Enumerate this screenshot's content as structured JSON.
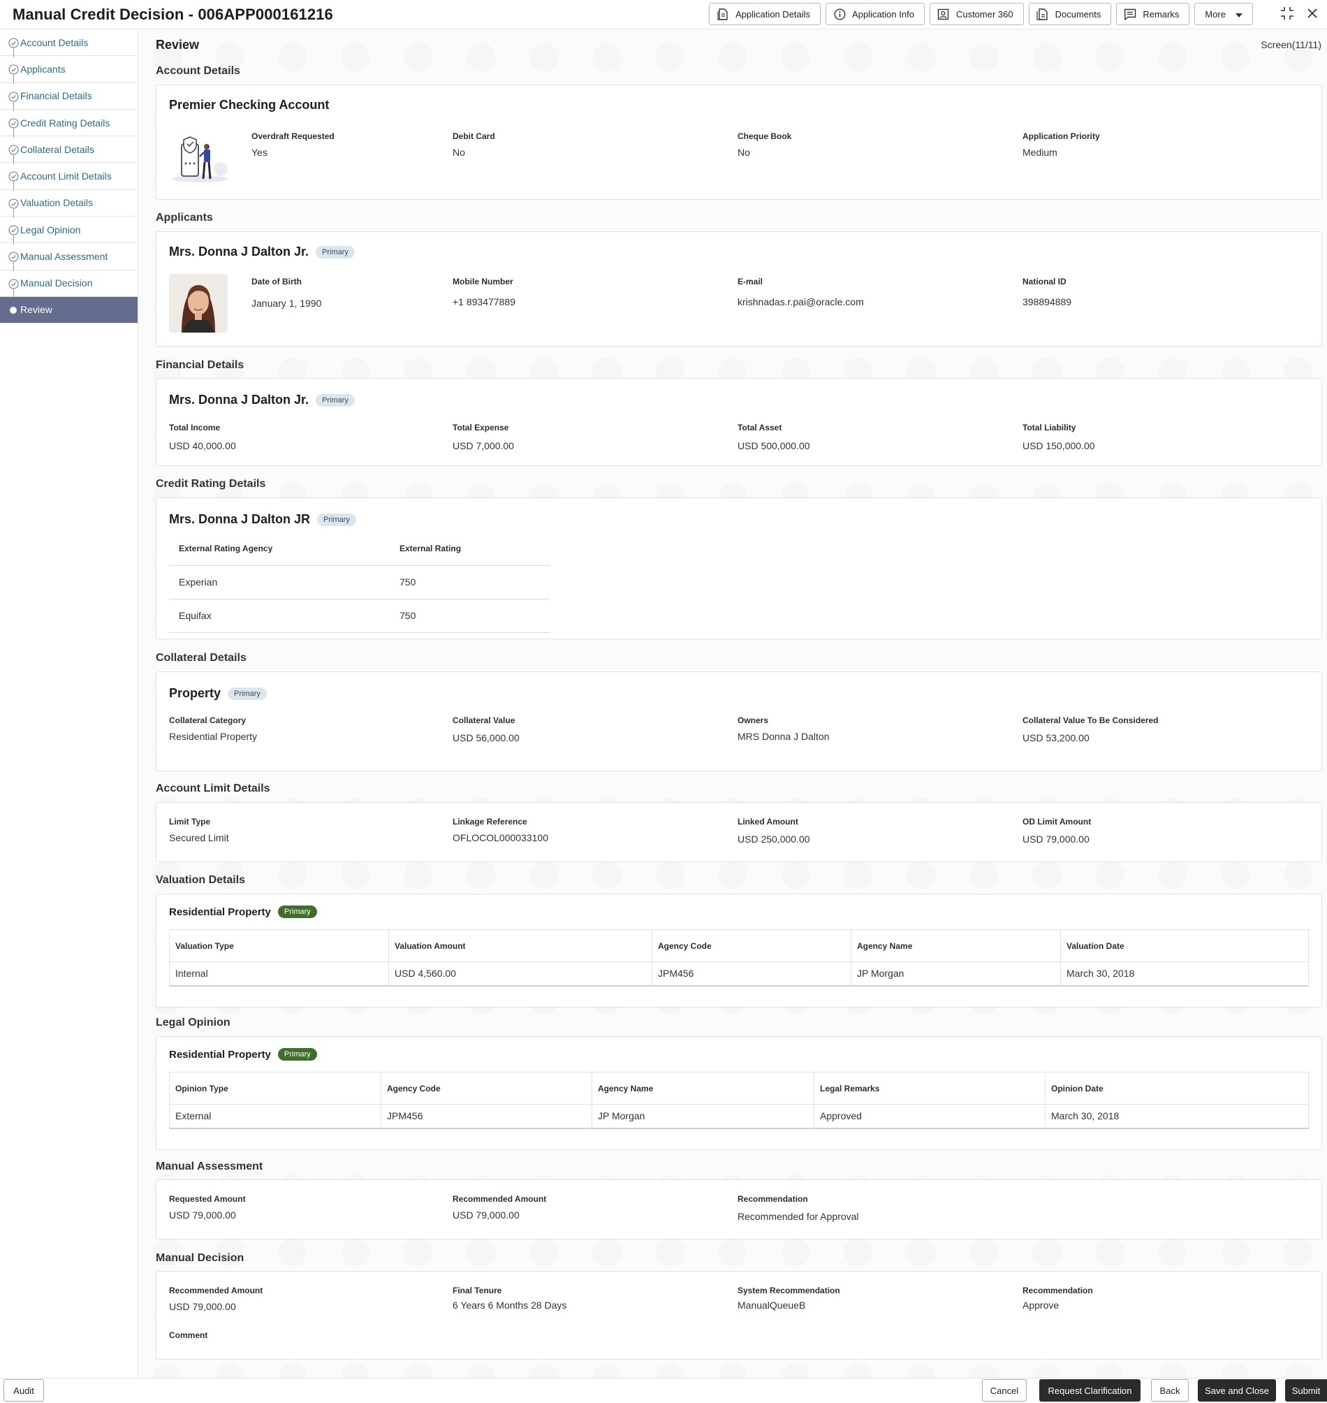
{
  "header": {
    "title": "Manual Credit Decision - 006APP000161216",
    "buttons": {
      "application_details": "Application Details",
      "application_info": "Application Info",
      "customer_360": "Customer 360",
      "documents": "Documents",
      "remarks": "Remarks",
      "more": "More"
    }
  },
  "sidebar": {
    "items": [
      {
        "label": "Account Details"
      },
      {
        "label": "Applicants"
      },
      {
        "label": "Financial Details"
      },
      {
        "label": "Credit Rating Details"
      },
      {
        "label": "Collateral Details"
      },
      {
        "label": "Account Limit Details"
      },
      {
        "label": "Valuation Details"
      },
      {
        "label": "Legal Opinion"
      },
      {
        "label": "Manual Assessment"
      },
      {
        "label": "Manual Decision"
      },
      {
        "label": "Review"
      }
    ]
  },
  "main": {
    "title": "Review",
    "screen_count": "Screen(11/11)"
  },
  "account_details": {
    "section_title": "Account Details",
    "product_name": "Premier Checking Account",
    "fields": [
      {
        "label": "Overdraft Requested",
        "value": "Yes"
      },
      {
        "label": "Debit Card",
        "value": "No"
      },
      {
        "label": "Cheque Book",
        "value": "No"
      },
      {
        "label": "Application Priority",
        "value": "Medium"
      }
    ]
  },
  "applicants": {
    "section_title": "Applicants",
    "name": "Mrs. Donna J Dalton Jr.",
    "badge": "Primary",
    "fields": [
      {
        "label": "Date of Birth",
        "value": "January 1, 1990"
      },
      {
        "label": "Mobile Number",
        "value": "+1 893477889"
      },
      {
        "label": "E-mail",
        "value": "krishnadas.r.pai@oracle.com"
      },
      {
        "label": "National ID",
        "value": "398894889"
      }
    ]
  },
  "financial_details": {
    "section_title": "Financial Details",
    "name": "Mrs. Donna J Dalton Jr.",
    "badge": "Primary",
    "fields": [
      {
        "label": "Total Income",
        "value": "USD 40,000.00"
      },
      {
        "label": "Total Expense",
        "value": "USD 7,000.00"
      },
      {
        "label": "Total Asset",
        "value": "USD 500,000.00"
      },
      {
        "label": "Total Liability",
        "value": "USD 150,000.00"
      }
    ]
  },
  "credit_rating": {
    "section_title": "Credit Rating Details",
    "name": "Mrs. Donna J Dalton JR",
    "badge": "Primary",
    "columns": [
      "External Rating Agency",
      "External Rating"
    ],
    "rows": [
      {
        "agency": "Experian",
        "rating": "750"
      },
      {
        "agency": "Equifax",
        "rating": "750"
      }
    ]
  },
  "collateral": {
    "section_title": "Collateral Details",
    "name": "Property",
    "badge": "Primary",
    "fields": [
      {
        "label": "Collateral Category",
        "value": "Residential Property"
      },
      {
        "label": "Collateral Value",
        "value": "USD 56,000.00"
      },
      {
        "label": "Owners",
        "value": "MRS Donna J Dalton"
      },
      {
        "label": "Collateral Value To Be Considered",
        "value": "USD 53,200.00"
      }
    ]
  },
  "account_limit": {
    "section_title": "Account Limit Details",
    "fields": [
      {
        "label": "Limit Type",
        "value": "Secured Limit"
      },
      {
        "label": "Linkage Reference",
        "value": "OFLOCOL000033100"
      },
      {
        "label": "Linked Amount",
        "value": "USD 250,000.00"
      },
      {
        "label": "OD Limit Amount",
        "value": "USD 79,000.00"
      }
    ]
  },
  "valuation": {
    "section_title": "Valuation Details",
    "name": "Residential Property",
    "badge": "Primary",
    "columns": [
      "Valuation Type",
      "Valuation Amount",
      "Agency Code",
      "Agency Name",
      "Valuation Date"
    ],
    "row": [
      "Internal",
      "USD 4,560.00",
      "JPM456",
      "JP Morgan",
      "March 30, 2018"
    ]
  },
  "legal_opinion": {
    "section_title": "Legal Opinion",
    "name": "Residential Property",
    "badge": "Primary",
    "columns": [
      "Opinion Type",
      "Agency Code",
      "Agency Name",
      "Legal Remarks",
      "Opinion Date"
    ],
    "row": [
      "External",
      "JPM456",
      "JP Morgan",
      "Approved",
      "March 30, 2018"
    ]
  },
  "manual_assessment": {
    "section_title": "Manual Assessment",
    "fields": [
      {
        "label": "Requested Amount",
        "value": "USD 79,000.00"
      },
      {
        "label": "Recommended Amount",
        "value": "USD 79,000.00"
      },
      {
        "label": "Recommendation",
        "value": "Recommended for Approval"
      }
    ]
  },
  "manual_decision": {
    "section_title": "Manual Decision",
    "fields": [
      {
        "label": "Recommended Amount",
        "value": "USD 79,000.00"
      },
      {
        "label": "Final Tenure",
        "value": "6 Years 6 Months 28 Days"
      },
      {
        "label": "System Recommendation",
        "value": "ManualQueueB"
      },
      {
        "label": "Recommendation",
        "value": "Approve"
      }
    ],
    "comment_label": "Comment"
  },
  "footer": {
    "audit": "Audit",
    "cancel": "Cancel",
    "request_clarification": "Request Clarification",
    "back": "Back",
    "save_and_close": "Save and Close",
    "submit": "Submit"
  },
  "colors": {
    "sidebar_active": "#656d8e",
    "link": "#2d6b8a",
    "badge_green": "#3f6f2a",
    "badge_blue": "#dbe6ef",
    "dark_button": "#2c2b2b"
  }
}
